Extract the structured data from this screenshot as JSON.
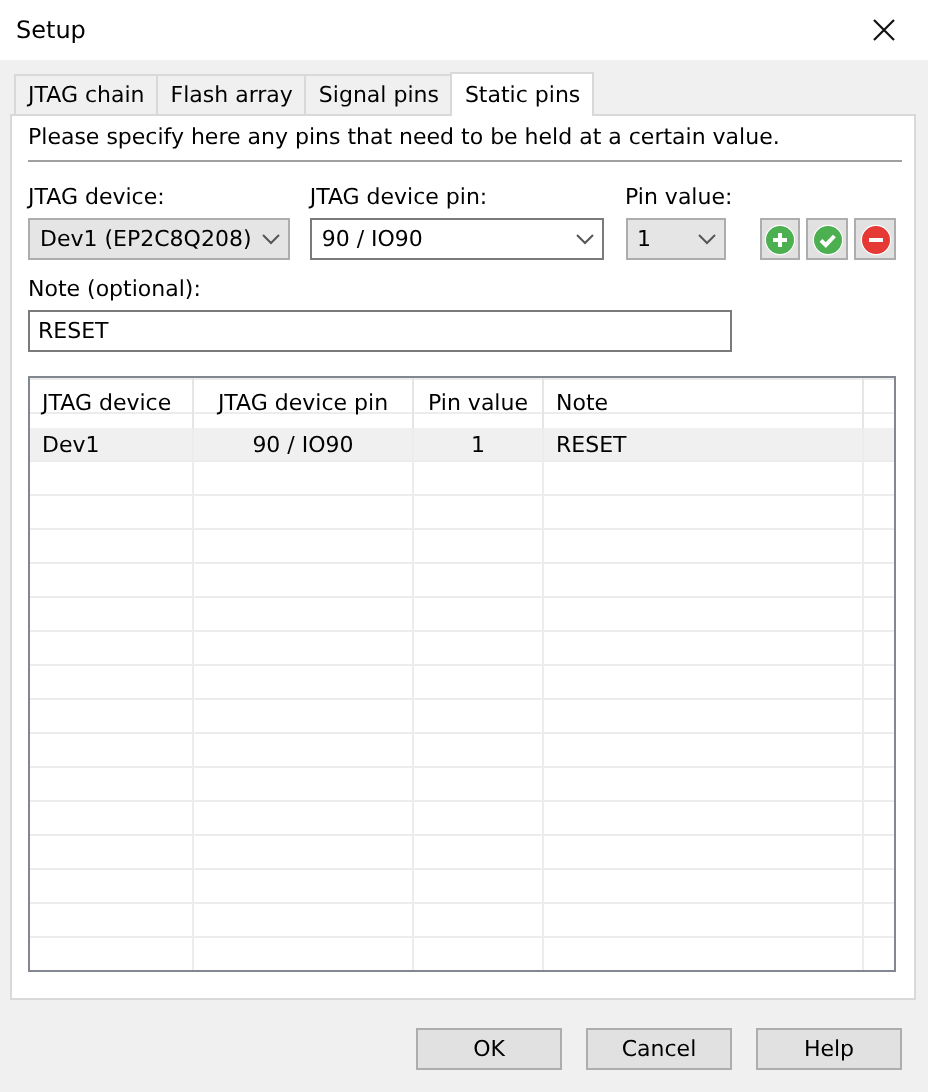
{
  "window": {
    "title": "Setup"
  },
  "tabs": [
    {
      "label": "JTAG chain",
      "selected": false
    },
    {
      "label": "Flash array",
      "selected": false
    },
    {
      "label": "Signal pins",
      "selected": false
    },
    {
      "label": "Static pins",
      "selected": true
    }
  ],
  "intro": "Please specify here any pins that need to be held at a certain value.",
  "fields": [
    {
      "label": "JTAG device:",
      "value": "Dev1 (EP2C8Q208)",
      "kind": "readonly"
    },
    {
      "label": "JTAG device pin:",
      "value": "90 / IO90",
      "kind": "editable"
    },
    {
      "label": "Pin value:",
      "value": "1",
      "kind": "readonly"
    }
  ],
  "actions": [
    {
      "kind": "add"
    },
    {
      "kind": "apply"
    },
    {
      "kind": "remove"
    }
  ],
  "note": {
    "label": "Note (optional):",
    "value": "RESET"
  },
  "table": {
    "columns": [
      "JTAG device",
      "JTAG device pin",
      "Pin value",
      "Note"
    ],
    "rows": [
      {
        "cells": [
          "Dev1",
          "90 / IO90",
          "1",
          "RESET"
        ],
        "selected": true
      }
    ]
  },
  "buttons": [
    "OK",
    "Cancel",
    "Help"
  ]
}
